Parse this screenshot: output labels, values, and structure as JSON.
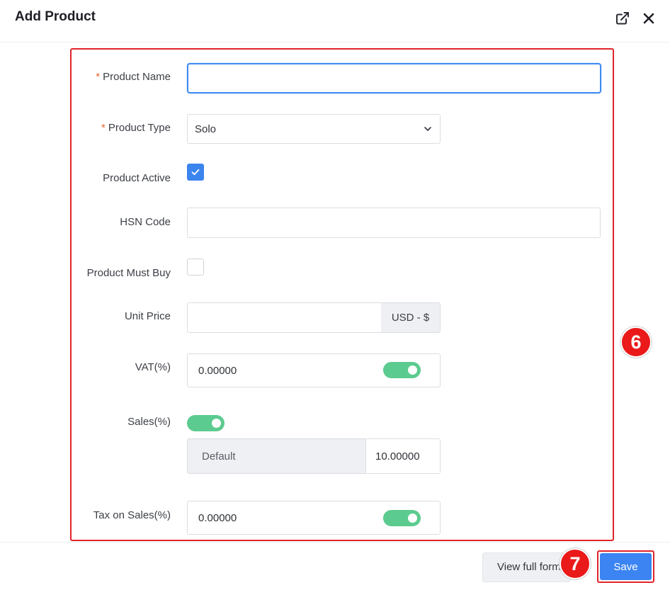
{
  "dialog": {
    "title": "Add Product",
    "open_new_window_icon": "external-link-icon",
    "close_icon": "close-icon"
  },
  "form": {
    "product_name": {
      "label": "Product Name",
      "required": "*",
      "value": ""
    },
    "product_type": {
      "label": "Product Type",
      "required": "*",
      "selected": "Solo",
      "icon": "chevron-down-icon"
    },
    "product_active": {
      "label": "Product Active",
      "checked": true
    },
    "hsn_code": {
      "label": "HSN Code",
      "value": ""
    },
    "product_must_buy": {
      "label": "Product Must Buy",
      "checked": false
    },
    "unit_price": {
      "label": "Unit Price",
      "value": "",
      "currency": "USD - $"
    },
    "vat": {
      "label": "VAT(%)",
      "value": "0.00000",
      "toggle_on": true
    },
    "sales": {
      "label": "Sales(%)",
      "toggle_on": true,
      "mode": "Default",
      "value": "10.00000"
    },
    "tax_on_sales": {
      "label": "Tax on Sales(%)",
      "value": "0.00000",
      "toggle_on": true
    }
  },
  "footer": {
    "view_full_form_label": "View full form",
    "save_label": "Save"
  },
  "annotations": {
    "form_marker": "6",
    "save_marker": "7"
  },
  "colors": {
    "accent": "#3b84f2",
    "toggle_on": "#5ccb8f",
    "highlight": "#e0242b",
    "required": "#e8652c"
  }
}
